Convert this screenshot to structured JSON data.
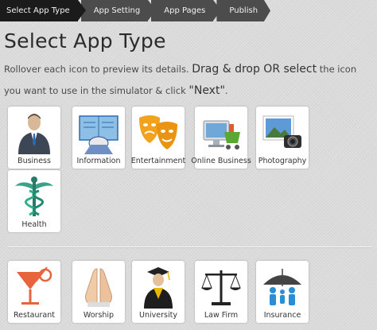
{
  "steps": [
    "Select App Type",
    "App Setting",
    "App Pages",
    "Publish"
  ],
  "heading": "Select App Type",
  "instructions": {
    "part1": "Rollover each icon to preview its details. ",
    "part2": "Drag & drop OR select",
    "part3": " the icon you want to use in the simulator & click ",
    "part4": "\"Next\"",
    "part5": "."
  },
  "categories_main": [
    {
      "label": "Business",
      "icon": "business-icon"
    },
    {
      "label": "Information",
      "icon": "information-icon"
    },
    {
      "label": "Entertainment",
      "icon": "entertainment-icon"
    },
    {
      "label": "Online Business",
      "icon": "online-business-icon"
    },
    {
      "label": "Photography",
      "icon": "photography-icon"
    },
    {
      "label": "Health",
      "icon": "health-icon"
    }
  ],
  "categories_more": [
    {
      "label": "Restaurant",
      "icon": "restaurant-icon"
    },
    {
      "label": "Worship",
      "icon": "worship-icon"
    },
    {
      "label": "University",
      "icon": "university-icon"
    },
    {
      "label": "Law Firm",
      "icon": "law-firm-icon"
    },
    {
      "label": "Insurance",
      "icon": "insurance-icon"
    }
  ],
  "colors": {
    "active_step": "#1b1b1b",
    "inactive_step": "#4c4c4c",
    "tile_bg": "#ffffff"
  }
}
